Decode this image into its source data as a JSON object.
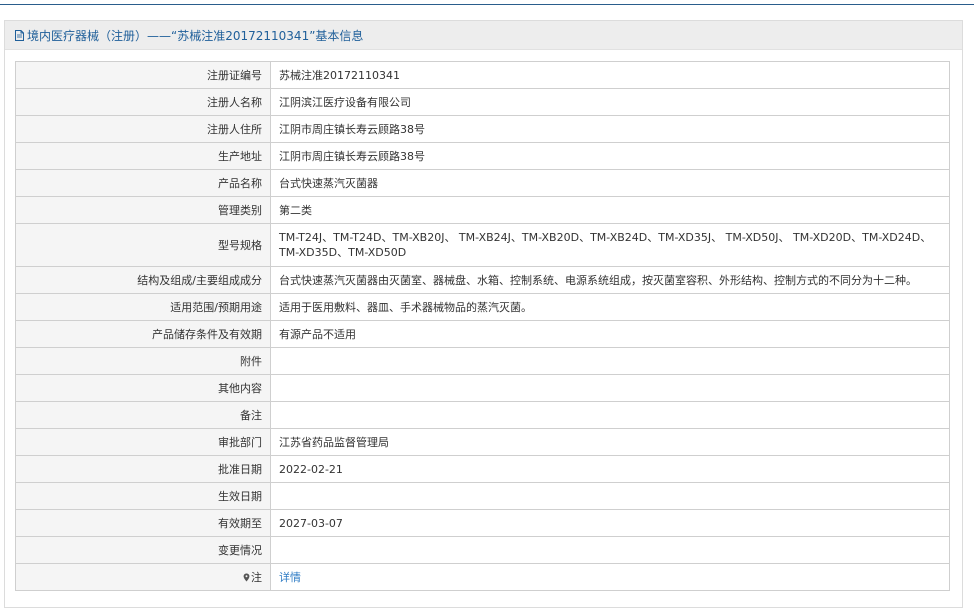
{
  "header": {
    "title": "境内医疗器械（注册）——“苏械注准20172110341”基本信息"
  },
  "rows": [
    {
      "label": "注册证编号",
      "value": "苏械注准20172110341"
    },
    {
      "label": "注册人名称",
      "value": "江阴滨江医疗设备有限公司"
    },
    {
      "label": "注册人住所",
      "value": "江阴市周庄镇长寿云顾路38号"
    },
    {
      "label": "生产地址",
      "value": "江阴市周庄镇长寿云顾路38号"
    },
    {
      "label": "产品名称",
      "value": "台式快速蒸汽灭菌器"
    },
    {
      "label": "管理类别",
      "value": "第二类"
    },
    {
      "label": "型号规格",
      "value": "TM-T24J、TM-T24D、TM-XB20J、 TM-XB24J、TM-XB20D、TM-XB24D、TM-XD35J、 TM-XD50J、 TM-XD20D、TM-XD24D、 TM-XD35D、TM-XD50D"
    },
    {
      "label": "结构及组成/主要组成成分",
      "value": "台式快速蒸汽灭菌器由灭菌室、器械盘、水箱、控制系统、电源系统组成，按灭菌室容积、外形结构、控制方式的不同分为十二种。"
    },
    {
      "label": "适用范围/预期用途",
      "value": "适用于医用敷料、器皿、手术器械物品的蒸汽灭菌。"
    },
    {
      "label": "产品储存条件及有效期",
      "value": "有源产品不适用"
    },
    {
      "label": "附件",
      "value": ""
    },
    {
      "label": "其他内容",
      "value": ""
    },
    {
      "label": "备注",
      "value": ""
    },
    {
      "label": "审批部门",
      "value": "江苏省药品监督管理局"
    },
    {
      "label": "批准日期",
      "value": "2022-02-21"
    },
    {
      "label": "生效日期",
      "value": ""
    },
    {
      "label": "有效期至",
      "value": "2027-03-07"
    },
    {
      "label": "变更情况",
      "value": ""
    }
  ],
  "note": {
    "label": "注",
    "link_text": "详情",
    "icon": "pin-icon"
  },
  "colors": {
    "header_text": "#1f5f9a",
    "link": "#2d7bc4",
    "label_bg": "#f5f5f5",
    "border": "#cfcfcf"
  }
}
